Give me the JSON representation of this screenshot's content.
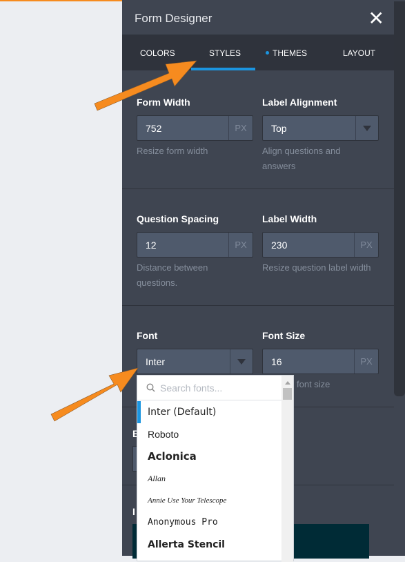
{
  "header": {
    "title": "Form Designer",
    "close_icon": "close-icon"
  },
  "tabs": [
    {
      "label": "COLORS"
    },
    {
      "label": "STYLES",
      "active": true
    },
    {
      "label": "THEMES",
      "dot": true
    },
    {
      "label": "LAYOUT"
    }
  ],
  "colors": {
    "accent": "#1b95e0",
    "arrow": "#f68b1f",
    "panel": "#3f4551",
    "teal_box": "#002b36"
  },
  "form_width": {
    "label": "Form Width",
    "value": "752",
    "unit": "PX",
    "hint": "Resize form width"
  },
  "label_alignment": {
    "label": "Label Alignment",
    "value": "Top",
    "hint": "Align questions and answers"
  },
  "question_spacing": {
    "label": "Question Spacing",
    "value": "12",
    "unit": "PX",
    "hint": "Distance between questions."
  },
  "label_width": {
    "label": "Label Width",
    "value": "230",
    "unit": "PX",
    "hint": "Resize question label width"
  },
  "font": {
    "label": "Font",
    "value": "Inter"
  },
  "font_size": {
    "label": "Font Size",
    "value": "16",
    "unit": "PX",
    "hint": "font size"
  },
  "partial_labels": [
    "B",
    "I"
  ],
  "font_dropdown": {
    "placeholder": "Search fonts...",
    "options": [
      "Inter (Default)",
      "Roboto",
      "Aclonica",
      "Allan",
      "Annie Use Your Telescope",
      "Anonymous Pro",
      "Allerta Stencil"
    ]
  }
}
